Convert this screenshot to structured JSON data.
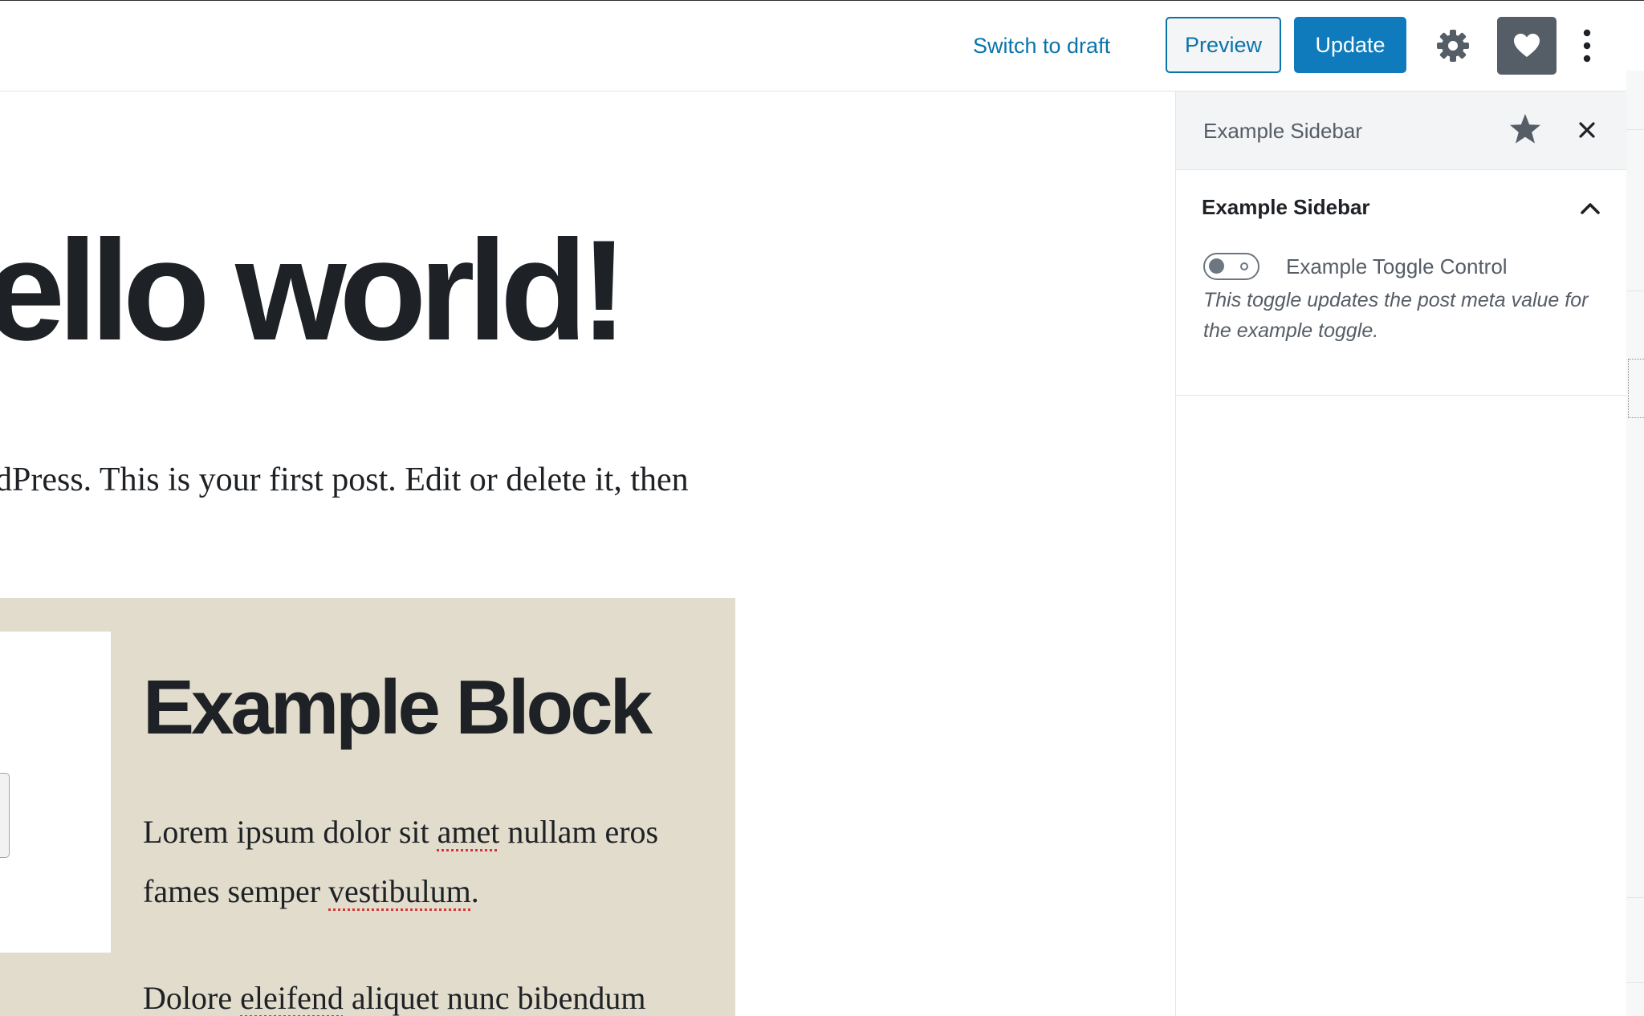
{
  "header": {
    "switch_to_draft": "Switch to draft",
    "preview": "Preview",
    "update": "Update",
    "icons": {
      "settings": "gear-icon",
      "plugin": "heart-icon",
      "more": "more-vertical-icon"
    }
  },
  "editor": {
    "title": "ello world!",
    "paragraph": "dPress. This is your first post. Edit or delete it, then",
    "example_block": {
      "heading": "Example Block",
      "text_1_parts": [
        "Lorem ipsum dolor sit ",
        "amet",
        " nullam eros",
        "fames semper ",
        "vestibulum",
        "."
      ],
      "text_2_parts": [
        "Dolore ",
        "eleifend",
        " aliquet nunc bibendum"
      ],
      "background_color": "#e1dccb"
    }
  },
  "sidebar": {
    "title": "Example Sidebar",
    "panel": {
      "title": "Example Sidebar",
      "expanded": true,
      "toggle": {
        "label": "Example Toggle Control",
        "checked": false,
        "help": "This toggle updates the post meta value for the example toggle."
      }
    },
    "icons": {
      "pin": "star-icon",
      "close": "close-icon",
      "collapse": "chevron-up-icon"
    }
  },
  "colors": {
    "accent": "#0a73aa",
    "update_button": "#0f7bbd",
    "plugin_button": "#555d66",
    "text": "#1e2125"
  }
}
